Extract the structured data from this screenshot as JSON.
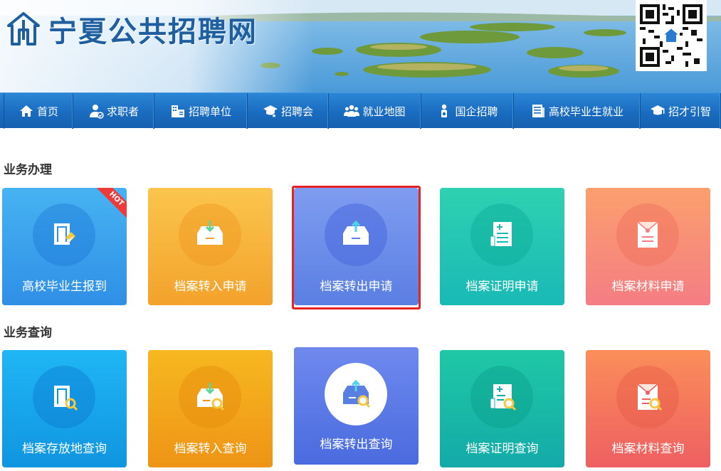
{
  "site": {
    "title": "宁夏公共招聘网"
  },
  "nav": {
    "items": [
      {
        "label": "首页",
        "icon": "home-icon"
      },
      {
        "label": "求职者",
        "icon": "job-seeker-icon"
      },
      {
        "label": "招聘单位",
        "icon": "company-building-icon"
      },
      {
        "label": "招聘会",
        "icon": "graduation-cap-star-icon"
      },
      {
        "label": "就业地图",
        "icon": "people-group-icon"
      },
      {
        "label": "国企招聘",
        "icon": "person-location-icon"
      },
      {
        "label": "高校毕业生就业",
        "icon": "document-list-icon"
      },
      {
        "label": "招才引智",
        "icon": "graduation-cap-icon"
      }
    ]
  },
  "business": {
    "title": "业务办理",
    "tiles": [
      {
        "label": "高校毕业生报到",
        "badge": "HOT",
        "icon": "graduate-report-icon",
        "color_top": "#47b3f2",
        "color_bottom": "#2f8fe6"
      },
      {
        "label": "档案转入申请",
        "icon": "archive-box-in-icon",
        "color_top": "#fbc54d",
        "color_bottom": "#f3a22b"
      },
      {
        "label": "档案转出申请",
        "icon": "archive-box-out-icon",
        "color_top": "#7f9cf0",
        "color_bottom": "#5a7fe3"
      },
      {
        "label": "档案证明申请",
        "icon": "certificate-document-icon",
        "color_top": "#2fd1b1",
        "color_bottom": "#19b9b6"
      },
      {
        "label": "档案材料申请",
        "icon": "archive-envelope-icon",
        "color_top": "#fb9f6e",
        "color_bottom": "#f47d83"
      }
    ]
  },
  "query": {
    "title": "业务查询",
    "tiles": [
      {
        "label": "档案存放地查询",
        "icon": "archive-location-search-icon",
        "color_top": "#1fb6f5",
        "color_bottom": "#1095e0"
      },
      {
        "label": "档案转入查询",
        "icon": "archive-box-in-search-icon",
        "color_top": "#f7b820",
        "color_bottom": "#ee9416"
      },
      {
        "label": "档案转出查询",
        "icon": "archive-box-out-search-icon",
        "color_top": "#6f89ee",
        "color_bottom": "#4a6bdf"
      },
      {
        "label": "档案证明查询",
        "icon": "certificate-search-icon",
        "color_top": "#1fc8a5",
        "color_bottom": "#13aaa8"
      },
      {
        "label": "档案材料查询",
        "icon": "archive-envelope-search-icon",
        "color_top": "#fb8e59",
        "color_bottom": "#ee5f61"
      }
    ]
  },
  "selected_tile": "档案转出申请",
  "colors": {
    "nav": "#1a6cc0",
    "title_blue": "#1f5fa0",
    "selection_outline": "#e62222"
  }
}
